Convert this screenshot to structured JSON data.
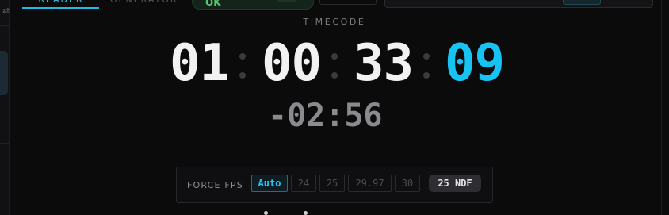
{
  "sidebar": {
    "toggle_icon": "swap-icon",
    "toggle_glyph": "⇄"
  },
  "tabs": [
    {
      "label": "READER",
      "active": true
    },
    {
      "label": "GENERATOR",
      "active": false
    }
  ],
  "status": {
    "label": "OK",
    "color": "#58c76c"
  },
  "timecode": {
    "heading": "TIMECODE",
    "hours": "01",
    "minutes": "00",
    "seconds": "33",
    "frames": "09",
    "frames_color": "#16c3f3"
  },
  "countdown": "-02:56",
  "force_fps": {
    "label": "FORCE FPS",
    "options": [
      "Auto",
      "24",
      "25",
      "29.97",
      "30"
    ],
    "selected": "Auto",
    "detected": "25 NDF"
  },
  "colors": {
    "accent": "#22b8e6",
    "background": "#0b0b0c"
  }
}
